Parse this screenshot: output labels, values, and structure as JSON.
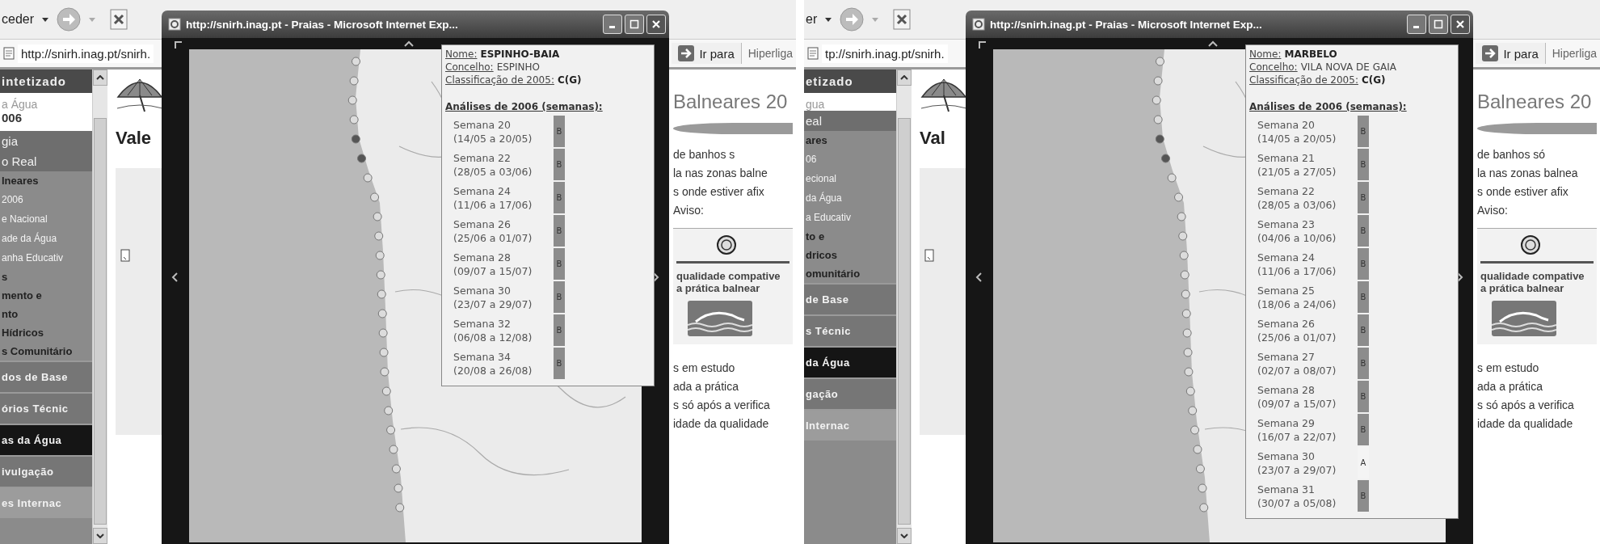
{
  "screens": [
    {
      "browser": {
        "back_label": "ceder",
        "address": "http://snirh.inag.pt/snirh.",
        "go_label": "Ir para",
        "links_label": "Hiperliga"
      },
      "sidebar": [
        {
          "kind": "title",
          "label": "intetizado"
        },
        {
          "kind": "logo-caption",
          "label": "a Água"
        },
        {
          "kind": "logo-year",
          "label": "006"
        },
        {
          "kind": "banner",
          "label": "gia"
        },
        {
          "kind": "banner",
          "label": "o Real"
        },
        {
          "kind": "heading",
          "label": "lneares"
        },
        {
          "kind": "link",
          "label": "2006"
        },
        {
          "kind": "link",
          "label": "e Nacional"
        },
        {
          "kind": "link",
          "label": "ade da Água"
        },
        {
          "kind": "link",
          "label": "anha Educativ"
        },
        {
          "kind": "heading",
          "label": "s"
        },
        {
          "kind": "heading",
          "label": "mento e"
        },
        {
          "kind": "heading",
          "label": "nto"
        },
        {
          "kind": "heading",
          "label": "Hídricos"
        },
        {
          "kind": "heading",
          "label": "s Comunitário"
        },
        {
          "kind": "band",
          "label": "dos de Base"
        },
        {
          "kind": "band",
          "label": "órios Técnic"
        },
        {
          "kind": "band-active",
          "label": "as da Água"
        },
        {
          "kind": "band",
          "label": "ivulgação"
        },
        {
          "kind": "band-light",
          "label": "es Internac"
        }
      ],
      "page": {
        "heading": "Vale",
        "title": "Balneares 20",
        "lines_top": [
          "de banhos s",
          "la nas zonas balne",
          "s onde estiver afix",
          "Aviso:"
        ],
        "poster_headline": [
          "qualidade compative",
          "a prática balnear"
        ],
        "lines_bottom": [
          "s em estudo",
          "ada a prática",
          "s só após a verifica",
          "idade da qualidade"
        ]
      },
      "popup": {
        "title": "http://snirh.inag.pt - Praias - Microsoft Internet Exp...",
        "info": {
          "fields": [
            {
              "label": "Nome:",
              "value": "ESPINHO-BAIA",
              "bold": true
            },
            {
              "label": "Concelho:",
              "value": "ESPINHO",
              "bold": false
            },
            {
              "label": "Classificação de 2005:",
              "value": "C(G)",
              "bold": true
            }
          ],
          "analyses_title": "Análises de 2006 (semanas):",
          "weeks": [
            {
              "label": "Semana 20",
              "dates": "(14/05 a 20/05)",
              "grade": "B",
              "color": "#8c8c8c"
            },
            {
              "label": "Semana 22",
              "dates": "(28/05 a 03/06)",
              "grade": "B",
              "color": "#8c8c8c"
            },
            {
              "label": "Semana 24",
              "dates": "(11/06 a 17/06)",
              "grade": "B",
              "color": "#8c8c8c"
            },
            {
              "label": "Semana 26",
              "dates": "(25/06 a 01/07)",
              "grade": "B",
              "color": "#8c8c8c"
            },
            {
              "label": "Semana 28",
              "dates": "(09/07 a 15/07)",
              "grade": "B",
              "color": "#8c8c8c"
            },
            {
              "label": "Semana 30",
              "dates": "(23/07 a 29/07)",
              "grade": "B",
              "color": "#8c8c8c"
            },
            {
              "label": "Semana 32",
              "dates": "(06/08 a 12/08)",
              "grade": "B",
              "color": "#8c8c8c"
            },
            {
              "label": "Semana 34",
              "dates": "(20/08 a 26/08)",
              "grade": "B",
              "color": "#8c8c8c"
            }
          ]
        }
      }
    },
    {
      "browser": {
        "back_label": "er",
        "address": "tp://snirh.inag.pt/snirh.",
        "go_label": "Ir para",
        "links_label": "Hiperliga"
      },
      "sidebar": [
        {
          "kind": "title",
          "label": "etizado"
        },
        {
          "kind": "logo-caption",
          "label": "gua"
        },
        {
          "kind": "banner",
          "label": "eal"
        },
        {
          "kind": "heading",
          "label": "ares"
        },
        {
          "kind": "link",
          "label": "06"
        },
        {
          "kind": "link",
          "label": "ecional"
        },
        {
          "kind": "link",
          "label": "da Água"
        },
        {
          "kind": "link",
          "label": "a Educativ"
        },
        {
          "kind": "heading",
          "label": "to e"
        },
        {
          "kind": "heading",
          "label": "dricos"
        },
        {
          "kind": "heading",
          "label": "omunitário"
        },
        {
          "kind": "band",
          "label": "de Base"
        },
        {
          "kind": "band",
          "label": "s Técnic"
        },
        {
          "kind": "band-active",
          "label": "da Água"
        },
        {
          "kind": "band",
          "label": "gação"
        },
        {
          "kind": "band-light",
          "label": "Internac"
        }
      ],
      "page": {
        "heading": "Val",
        "title": "Balneares 20",
        "lines_top": [
          "de banhos só",
          "la nas zonas balnea",
          "s onde estiver afix",
          "Aviso:"
        ],
        "poster_headline": [
          "qualidade compative",
          "a prática balnear"
        ],
        "lines_bottom": [
          "s em estudo",
          "ada a prática",
          "s só após a verifica",
          "idade da qualidade"
        ]
      },
      "popup": {
        "title": "http://snirh.inag.pt - Praias - Microsoft Internet Exp...",
        "info": {
          "fields": [
            {
              "label": "Nome:",
              "value": "MARBELO",
              "bold": true
            },
            {
              "label": "Concelho:",
              "value": "VILA NOVA DE GAIA",
              "bold": false
            },
            {
              "label": "Classificação de 2005:",
              "value": "C(G)",
              "bold": true
            }
          ],
          "analyses_title": "Análises de 2006 (semanas):",
          "weeks": [
            {
              "label": "Semana 20",
              "dates": "(14/05 a 20/05)",
              "grade": "B",
              "color": "#8c8c8c"
            },
            {
              "label": "Semana 21",
              "dates": "(21/05 a 27/05)",
              "grade": "B",
              "color": "#8c8c8c"
            },
            {
              "label": "Semana 22",
              "dates": "(28/05 a 03/06)",
              "grade": "B",
              "color": "#8c8c8c"
            },
            {
              "label": "Semana 23",
              "dates": "(04/06 a 10/06)",
              "grade": "B",
              "color": "#8c8c8c"
            },
            {
              "label": "Semana 24",
              "dates": "(11/06 a 17/06)",
              "grade": "B",
              "color": "#8c8c8c"
            },
            {
              "label": "Semana 25",
              "dates": "(18/06 a 24/06)",
              "grade": "B",
              "color": "#8c8c8c"
            },
            {
              "label": "Semana 26",
              "dates": "(25/06 a 01/07)",
              "grade": "B",
              "color": "#8c8c8c"
            },
            {
              "label": "Semana 27",
              "dates": "(02/07 a 08/07)",
              "grade": "B",
              "color": "#8c8c8c"
            },
            {
              "label": "Semana 28",
              "dates": "(09/07 a 15/07)",
              "grade": "B",
              "color": "#8c8c8c"
            },
            {
              "label": "Semana 29",
              "dates": "(16/07 a 22/07)",
              "grade": "B",
              "color": "#8c8c8c"
            },
            {
              "label": "Semana 30",
              "dates": "(23/07 a 29/07)",
              "grade": "A",
              "color": "#f4f4f4"
            },
            {
              "label": "Semana 31",
              "dates": "(30/07 a 05/08)",
              "grade": "B",
              "color": "#8c8c8c"
            }
          ]
        }
      }
    }
  ]
}
